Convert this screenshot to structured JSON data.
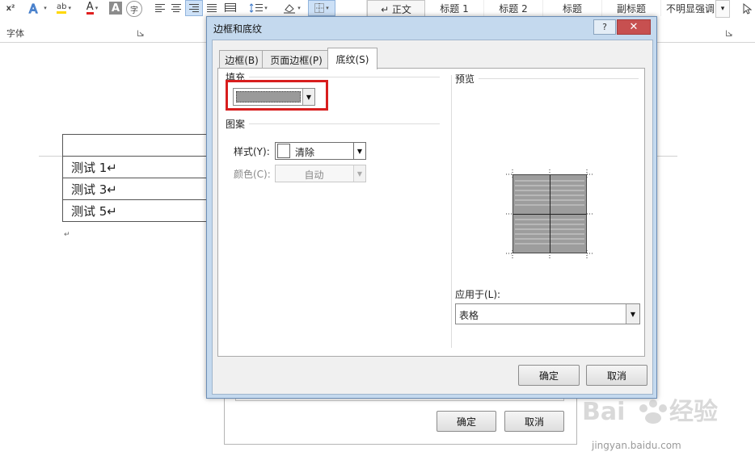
{
  "ribbon": {
    "font_group_label": "字体",
    "style_items": [
      {
        "label": "↵ 正文",
        "active": true
      },
      {
        "label": "标题 1",
        "active": false
      },
      {
        "label": "标题 2",
        "active": false
      },
      {
        "label": "标题",
        "active": false
      },
      {
        "label": "副标题",
        "active": false
      },
      {
        "label": "不明显强调",
        "active": false
      }
    ],
    "superscript_label": "x²",
    "font_color_letter": "A",
    "char_shading_letter": "A",
    "enclose_char": "字",
    "highlight_text": "ab"
  },
  "document": {
    "rows": [
      "测试 1↵",
      "测试 3↵",
      "测试 5↵"
    ],
    "para_mark": "↵"
  },
  "background_dialog": {
    "ok_label": "确定",
    "cancel_label": "取消"
  },
  "dialog": {
    "title": "边框和底纹",
    "help_label": "?",
    "close_label": "✕",
    "tabs": [
      {
        "label": "边框(B)",
        "active": false
      },
      {
        "label": "页面边框(P)",
        "active": false
      },
      {
        "label": "底纹(S)",
        "active": true
      }
    ],
    "fill_section": "填充",
    "pattern_section": "图案",
    "style_label": "样式(Y):",
    "style_value": "清除",
    "color_label": "颜色(C):",
    "color_value": "自动",
    "preview_label": "预览",
    "apply_label": "应用于(L):",
    "apply_value": "表格",
    "ok_label": "确定",
    "cancel_label": "取消",
    "fill_color": "#9a9a9a",
    "highlight_color": "#d81e1e"
  },
  "watermark": {
    "text": "jingyan.baidu.com",
    "brand": "Baidu经验"
  }
}
